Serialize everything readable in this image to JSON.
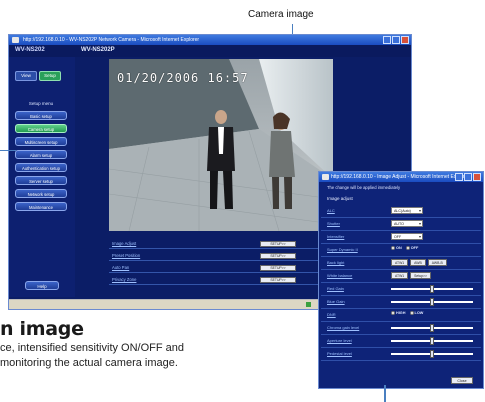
{
  "callout": {
    "label": "Camera image"
  },
  "section": {
    "heading": "n image",
    "line1": "ce, intensified sensitivity ON/OFF and",
    "line2": "monitoring the actual camera image."
  },
  "main_window": {
    "title": "http://192.168.0.10 - WV-NS202P Network Camera - Microsoft Internet Explorer",
    "logo": "WV-NS202",
    "model": "WV-NS202P",
    "view_label": "View",
    "setup_label": "Setup",
    "sidebar_title": "Setup menu",
    "menu": [
      {
        "label": "Basic setup"
      },
      {
        "label": "Camera setup",
        "active": true
      },
      {
        "label": "Multiscreen setup"
      },
      {
        "label": "Alarm setup"
      },
      {
        "label": "Authentication setup"
      },
      {
        "label": "Server setup"
      },
      {
        "label": "Network setup"
      },
      {
        "label": "Maintenance"
      }
    ],
    "help_label": "Help",
    "timestamp": "01/20/2006 16:57",
    "rows": [
      {
        "label": "Image Adjust",
        "button": "SETUP>>"
      },
      {
        "label": "Preset Position",
        "button": "SETUP>>"
      },
      {
        "label": "Auto Pan",
        "button": "SETUP>>"
      },
      {
        "label": "Privacy Zone",
        "button": "SETUP>>"
      }
    ]
  },
  "adjust_window": {
    "title": "http://192.168.0.10 - Image Adjust - Microsoft Internet Explorer",
    "hint": "The change will be applied immediately",
    "subtitle": "Image adjust",
    "rows": [
      {
        "label": "ALC",
        "type": "select",
        "value": "ALC(Auto)"
      },
      {
        "label": "Shutter",
        "type": "select",
        "value": "AUTO"
      },
      {
        "label": "Intensifier",
        "type": "select",
        "value": "OFF"
      },
      {
        "label": "Super Dynamic II",
        "type": "radio",
        "options": [
          "ON",
          "OFF"
        ]
      },
      {
        "label": "Back light",
        "type": "buttons",
        "options": [
          "ATW1",
          "AWB",
          "AWB-B"
        ]
      },
      {
        "label": "White balance",
        "type": "buttons",
        "options": [
          "ATW1",
          "Setup>>"
        ]
      },
      {
        "label": "Red Gain",
        "type": "slider",
        "level": 0.5
      },
      {
        "label": "Blue Gain",
        "type": "slider",
        "level": 0.5
      },
      {
        "label": "DNR",
        "type": "radio",
        "options": [
          "HIGH",
          "LOW"
        ]
      },
      {
        "label": "Chroma gain level",
        "type": "slider",
        "level": 0.5
      },
      {
        "label": "Aperture level",
        "type": "slider",
        "level": 0.5
      },
      {
        "label": "Pedestal level",
        "type": "slider",
        "level": 0.5
      }
    ],
    "close_label": "Close"
  }
}
